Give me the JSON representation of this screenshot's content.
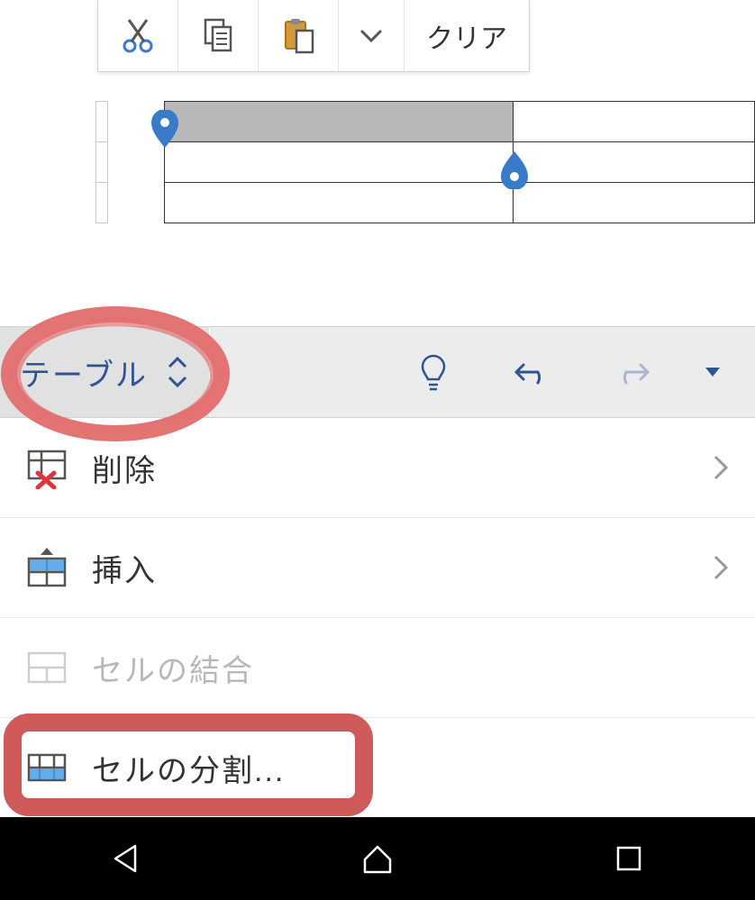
{
  "context_toolbar": {
    "cut_icon": "cut",
    "copy_icon": "copy",
    "paste_icon": "paste",
    "more_icon": "chevron-down",
    "clear_label": "クリア"
  },
  "ribbon": {
    "active_tab_label": "テーブル",
    "updown_icon": "expand",
    "bulb_icon": "tell-me",
    "undo_icon": "undo",
    "redo_icon": "redo",
    "dropdown_icon": "triangle-down"
  },
  "menu": {
    "items": [
      {
        "label": "削除",
        "icon": "table-delete",
        "enabled": true,
        "chevron": true
      },
      {
        "label": "挿入",
        "icon": "table-insert",
        "enabled": true,
        "chevron": true
      },
      {
        "label": "セルの結合",
        "icon": "cells-merge",
        "enabled": false,
        "chevron": false
      },
      {
        "label": "セルの分割...",
        "icon": "cells-split",
        "enabled": true,
        "chevron": false
      }
    ]
  },
  "annotations": [
    {
      "target": "ribbon-tab-table"
    },
    {
      "target": "menu-item-cells-split"
    }
  ],
  "nav": {
    "back": "back",
    "home": "home",
    "recent": "recent"
  }
}
